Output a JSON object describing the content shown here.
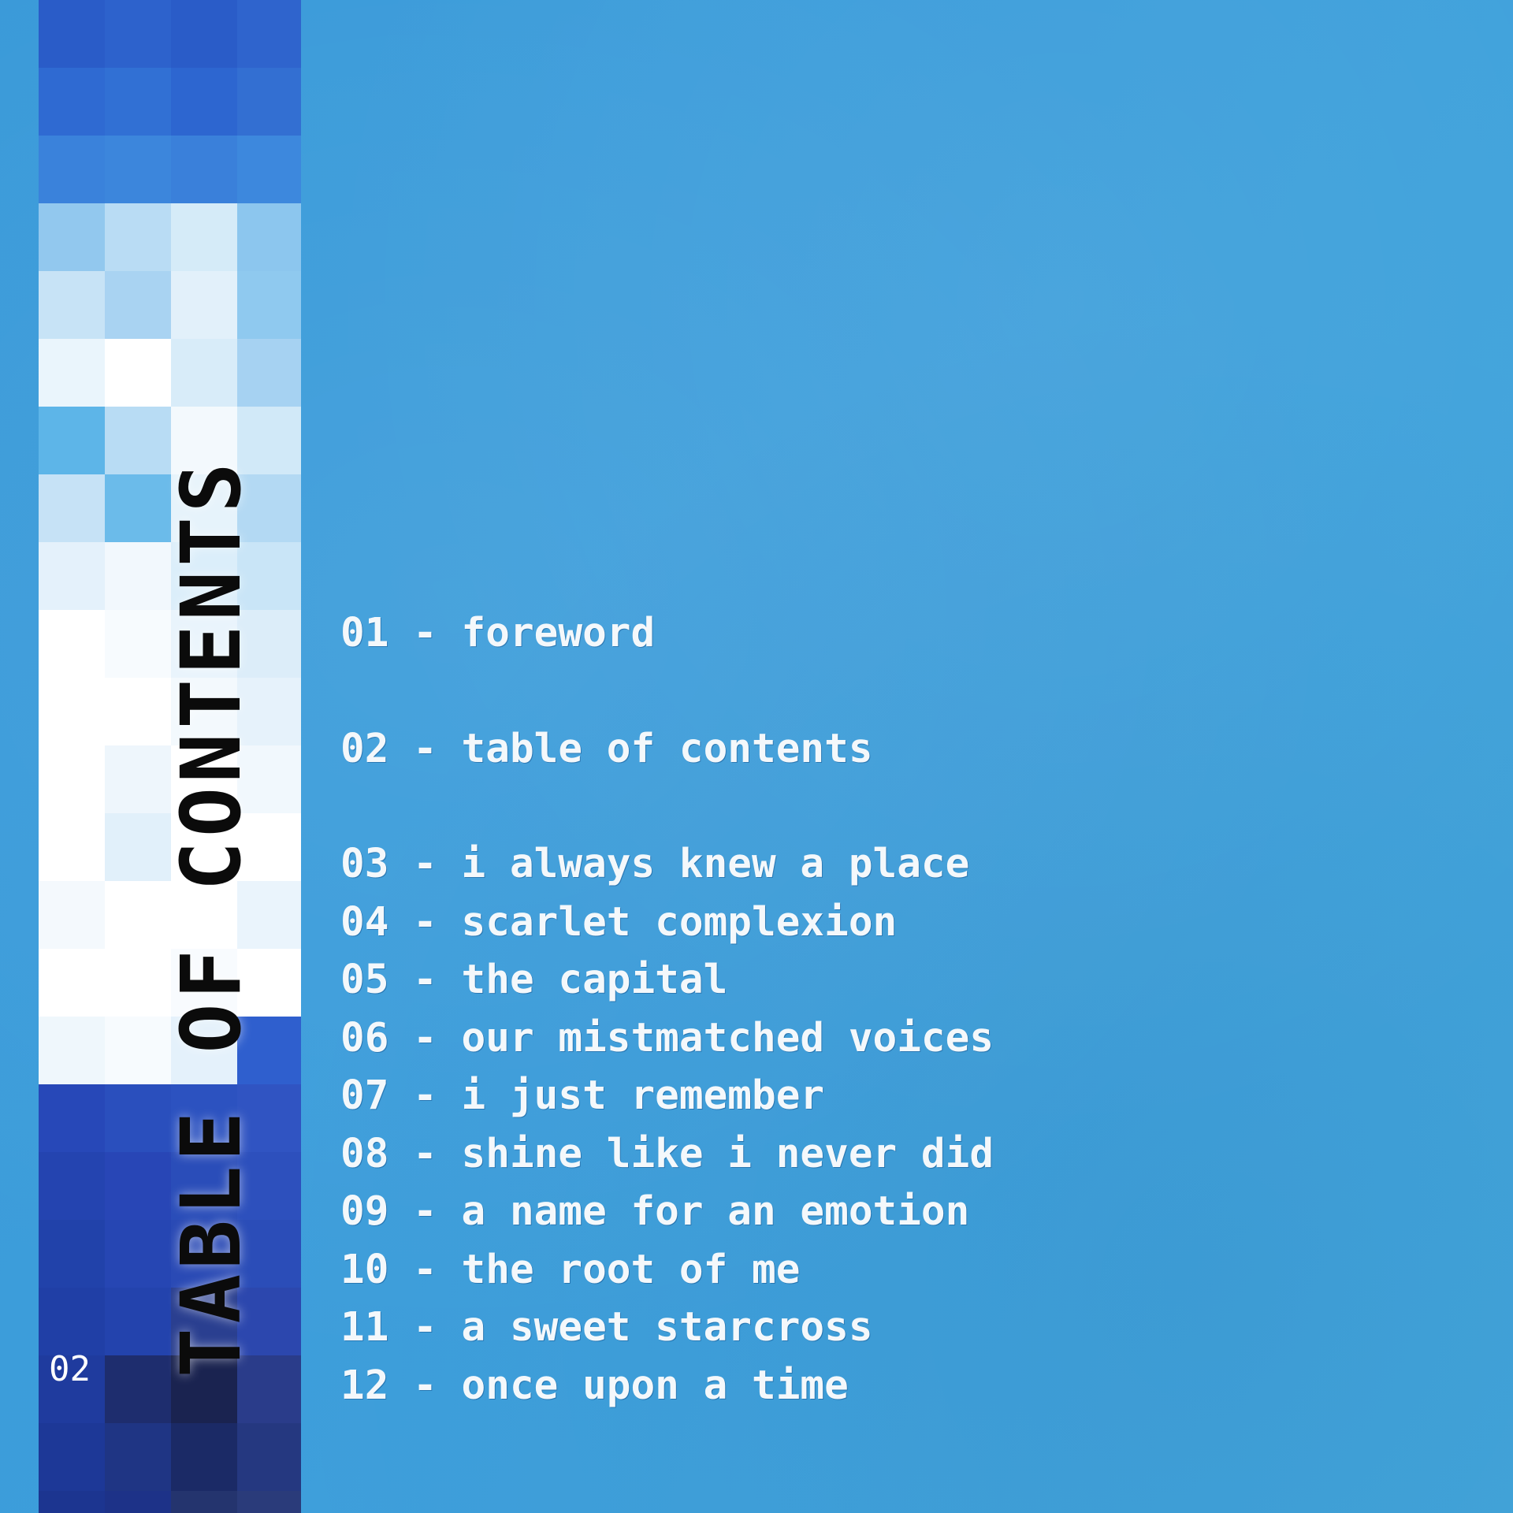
{
  "spine": {
    "title": "TABLE OF CONTENTS",
    "page_number": "02"
  },
  "toc": {
    "entries": [
      {
        "number": "01",
        "title": "foreword"
      },
      {
        "number": "02",
        "title": "table of contents"
      },
      {
        "number": "03",
        "title": "i always knew a place"
      },
      {
        "number": "04",
        "title": "scarlet complexion"
      },
      {
        "number": "05",
        "title": "the capital"
      },
      {
        "number": "06",
        "title": "our mistmatched voices"
      },
      {
        "number": "07",
        "title": "i just remember"
      },
      {
        "number": "08",
        "title": "shine like i never did"
      },
      {
        "number": "09",
        "title": "a name for an emotion"
      },
      {
        "number": "10",
        "title": "the root of me"
      },
      {
        "number": "11",
        "title": "a sweet starcross"
      },
      {
        "number": "12",
        "title": "once upon a time"
      }
    ]
  }
}
